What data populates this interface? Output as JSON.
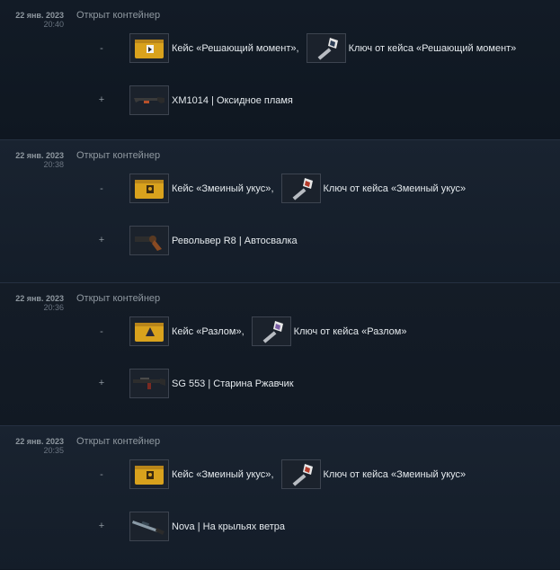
{
  "entries": [
    {
      "date": "22 янв. 2023",
      "time": "20:40",
      "event": "Открыт контейнер",
      "lost_sign": "-",
      "gained_sign": "+",
      "case": {
        "name": "Кейс «Решающий момент»",
        "icon": "decisive-moment-case-icon",
        "color": "#d9a21d"
      },
      "separator": ",",
      "key": {
        "name": "Ключ от кейса «Решающий момент»",
        "icon": "case-key-icon",
        "color": "#2c3d55"
      },
      "reward": {
        "name": "XM1014 | Оксидное пламя",
        "icon": "shotgun-icon"
      }
    },
    {
      "date": "22 янв. 2023",
      "time": "20:38",
      "event": "Открыт контейнер",
      "lost_sign": "-",
      "gained_sign": "+",
      "case": {
        "name": "Кейс «Змеиный укус»",
        "icon": "snakebite-case-icon",
        "color": "#d9a21d"
      },
      "separator": ",",
      "key": {
        "name": "Ключ от кейса «Змеиный укус»",
        "icon": "case-key-icon",
        "color": "#b33a2a"
      },
      "reward": {
        "name": "Револьвер R8 | Автосвалка",
        "icon": "revolver-icon"
      }
    },
    {
      "date": "22 янв. 2023",
      "time": "20:36",
      "event": "Открыт контейнер",
      "lost_sign": "-",
      "gained_sign": "+",
      "case": {
        "name": "Кейс «Разлом»",
        "icon": "fracture-case-icon",
        "color": "#d9a21d"
      },
      "separator": ",",
      "key": {
        "name": "Ключ от кейса «Разлом»",
        "icon": "case-key-icon",
        "color": "#7c5fa6"
      },
      "reward": {
        "name": "SG 553 | Старина Ржавчик",
        "icon": "rifle-icon"
      }
    },
    {
      "date": "22 янв. 2023",
      "time": "20:35",
      "event": "Открыт контейнер",
      "lost_sign": "-",
      "gained_sign": "+",
      "case": {
        "name": "Кейс «Змеиный укус»",
        "icon": "snakebite-case-icon",
        "color": "#d9a21d"
      },
      "separator": ",",
      "key": {
        "name": "Ключ от кейса «Змеиный укус»",
        "icon": "case-key-icon",
        "color": "#b33a2a"
      },
      "reward": {
        "name": "Nova | На крыльях ветра",
        "icon": "shotgun-icon"
      }
    }
  ]
}
